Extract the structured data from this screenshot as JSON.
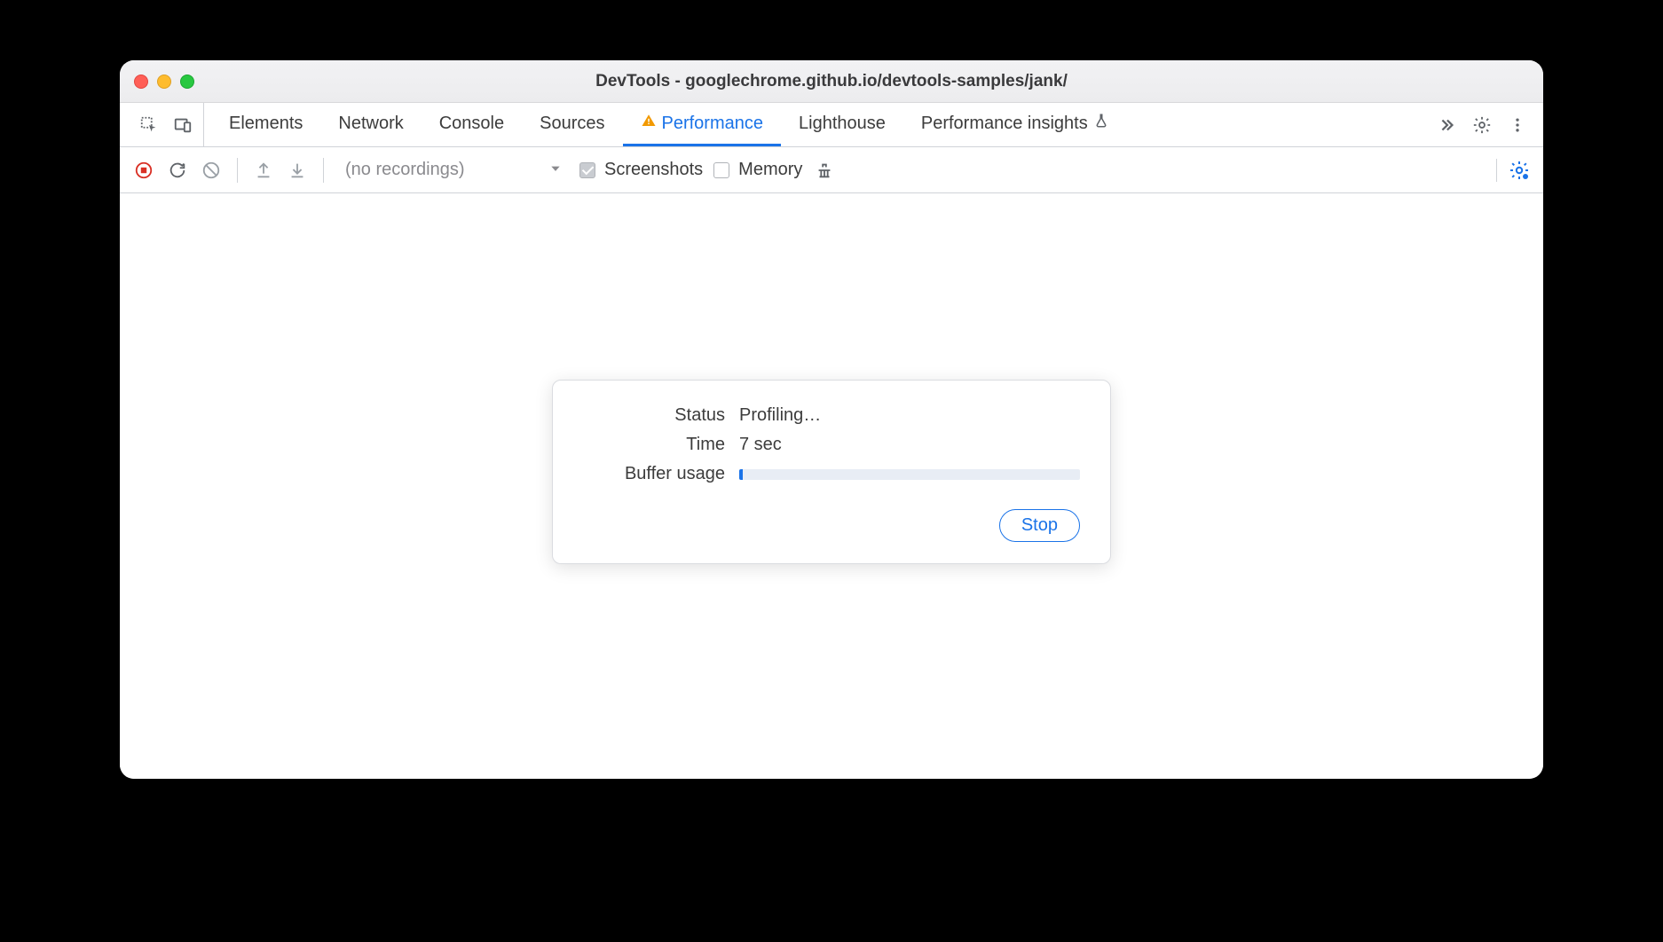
{
  "window": {
    "title": "DevTools - googlechrome.github.io/devtools-samples/jank/"
  },
  "tabs": {
    "items": [
      {
        "label": "Elements"
      },
      {
        "label": "Network"
      },
      {
        "label": "Console"
      },
      {
        "label": "Sources"
      },
      {
        "label": "Performance"
      },
      {
        "label": "Lighthouse"
      },
      {
        "label": "Performance insights"
      }
    ],
    "active_index": 4
  },
  "toolbar": {
    "recordings_placeholder": "(no recordings)",
    "screenshots_label": "Screenshots",
    "screenshots_checked": true,
    "memory_label": "Memory",
    "memory_checked": false
  },
  "dialog": {
    "status_label": "Status",
    "status_value": "Profiling…",
    "time_label": "Time",
    "time_value": "7 sec",
    "buffer_label": "Buffer usage",
    "buffer_percent": 1,
    "stop_label": "Stop"
  }
}
